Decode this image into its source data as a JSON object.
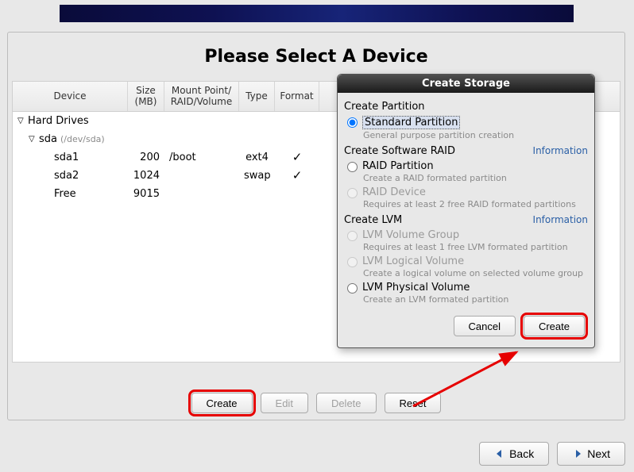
{
  "page": {
    "title": "Please Select A Device"
  },
  "table": {
    "headers": {
      "device": "Device",
      "size": "Size (MB)",
      "mount": "Mount Point/ RAID/Volume",
      "type": "Type",
      "format": "Format"
    },
    "rows": {
      "hard_drives": "Hard Drives",
      "sda": {
        "name": "sda",
        "path": "(/dev/sda)"
      },
      "sda1": {
        "name": "sda1",
        "size": "200",
        "mount": "/boot",
        "type": "ext4",
        "format": "✓"
      },
      "sda2": {
        "name": "sda2",
        "size": "1024",
        "mount": "",
        "type": "swap",
        "format": "✓"
      },
      "free": {
        "name": "Free",
        "size": "9015",
        "mount": "",
        "type": "",
        "format": ""
      }
    }
  },
  "actions": {
    "create": "Create",
    "edit": "Edit",
    "delete": "Delete",
    "reset": "Reset"
  },
  "footer": {
    "back": "Back",
    "next": "Next"
  },
  "dialog": {
    "title": "Create Storage",
    "sections": {
      "partition": {
        "title": "Create Partition"
      },
      "raid": {
        "title": "Create Software RAID",
        "info": "Information"
      },
      "lvm": {
        "title": "Create LVM",
        "info": "Information"
      }
    },
    "options": {
      "standard": {
        "label": "Standard Partition",
        "desc": "General purpose partition creation"
      },
      "raid_part": {
        "label": "RAID Partition",
        "desc": "Create a RAID formated partition"
      },
      "raid_dev": {
        "label": "RAID Device",
        "desc": "Requires at least 2 free RAID formated partitions"
      },
      "lvm_vg": {
        "label": "LVM Volume Group",
        "desc": "Requires at least 1 free LVM formated partition"
      },
      "lvm_lv": {
        "label": "LVM Logical Volume",
        "desc": "Create a logical volume on selected volume group"
      },
      "lvm_pv": {
        "label": "LVM Physical Volume",
        "desc": "Create an LVM formated partition"
      }
    },
    "buttons": {
      "cancel": "Cancel",
      "create": "Create"
    }
  }
}
